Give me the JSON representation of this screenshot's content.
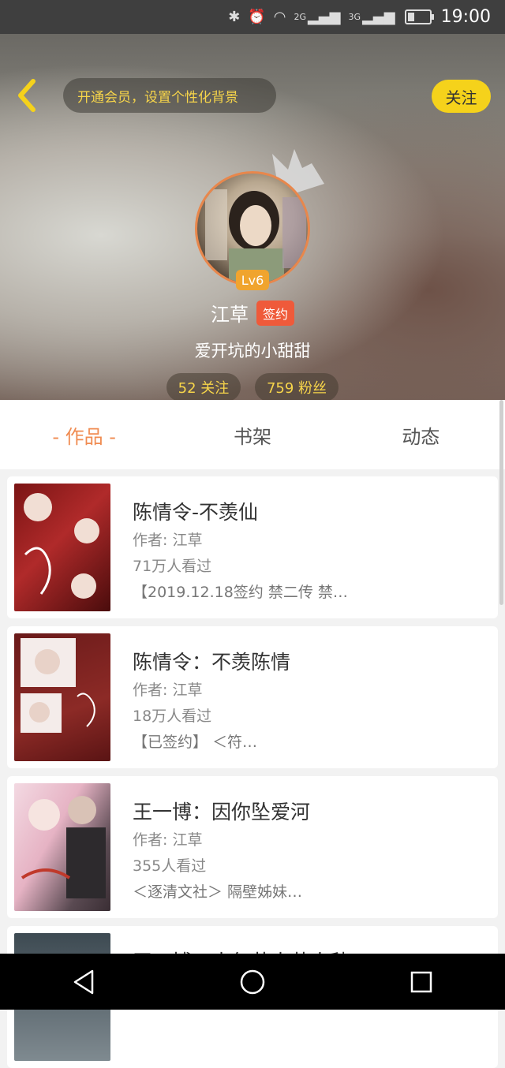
{
  "status_bar": {
    "network1": "2G",
    "network2": "3G",
    "time": "19:00"
  },
  "header": {
    "vip_banner": "开通会员，设置个性化背景",
    "follow_button": "关注"
  },
  "profile": {
    "level": "Lv6",
    "username": "江草",
    "badge": "签约",
    "bio": "爱开坑的小甜甜",
    "following": "52 关注",
    "fans": "759 粉丝"
  },
  "tabs": [
    {
      "label": "- 作品 -",
      "active": true
    },
    {
      "label": "书架",
      "active": false
    },
    {
      "label": "动态",
      "active": false
    }
  ],
  "works": [
    {
      "title": "陈情令-不羡仙",
      "author": "作者: 江草",
      "views": "71万人看过",
      "tags": "【2019.12.18签约  禁二传 禁…"
    },
    {
      "title": "陈情令：不羡陈情",
      "author": "作者: 江草",
      "views": "18万人看过",
      "tags": "【已签约】 ＜符…"
    },
    {
      "title": "王一博：因你坠爱河",
      "author": "作者: 江草",
      "views": "355人看过",
      "tags": "＜逐清文社＞ 隔壁姊妹…"
    },
    {
      "title": "王一博：十年若未若人秋",
      "author": "",
      "views": "",
      "tags": ""
    }
  ],
  "colors": {
    "accent": "#f08c52",
    "follow_button": "#f5d21b",
    "badge": "#ef5a3a",
    "level": "#f0a42e"
  }
}
